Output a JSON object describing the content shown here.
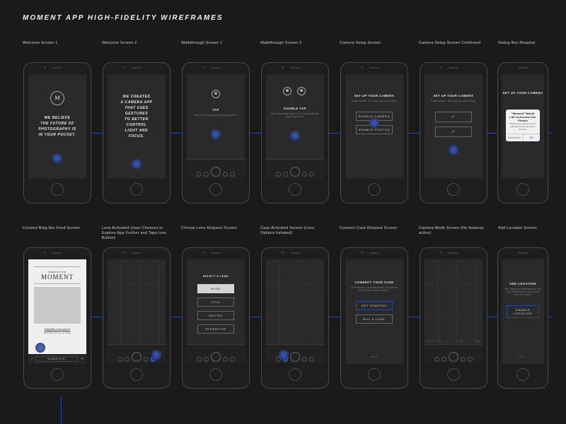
{
  "page_title": "MOMENT APP HIGH-FIDELITY WIREFRAMES",
  "accent_color": "#2b4a8f",
  "row1": [
    {
      "label": "Welcome Screen 1",
      "logo_letter": "M",
      "body": "WE BELIEVE\nTHE FUTURE OF\nPHOTOGRAPHY IS\nIN YOUR POCKET."
    },
    {
      "label": "Welcome Screen 2",
      "body": "WE CREATED\nA CAMERA APP\nTHAT USES\nGESTURES\nTO BETTER\nCONTROL\nLIGHT AND\nFOCUS."
    },
    {
      "label": "Walkthrough Screen 1",
      "gesture_title": "TAP",
      "gesture_sub": "Tap to set focus and exposure points."
    },
    {
      "label": "Walkthrough Screen 2",
      "gesture_title": "DOUBLE TAP",
      "gesture_sub": "Split focus and exposure to independently adjust each one."
    },
    {
      "label": "Camera Setup Screen",
      "title": "SET UP YOUR CAMERA",
      "sub": "To get started, we need your permission.",
      "buttons": [
        "ENABLE CAMERA",
        "ENABLE PHOTOS"
      ]
    },
    {
      "label": "Camera Setup Screen Confirmed",
      "title": "SET UP YOUR CAMERA",
      "sub": "To get started, we need your permission.",
      "checks": 2
    },
    {
      "label": "Dialog Box Request",
      "title": "SET UP YOUR CAMERA",
      "dialog_title": "\"Moment\" Would Like to Access Your Photos",
      "dialog_body": "Sharing your photos lets you edit and preview directly in the app.",
      "dialog_left": "Don't Allow",
      "dialog_right": "OK"
    }
  ],
  "row2": [
    {
      "label": "Curated Blog-like Feed Screen",
      "eyebrow": "Capture the",
      "hero": "MOMENT",
      "footer_link": "Everything I know and Do",
      "footer_sub": "Read More Photos | 2 Saves",
      "tab_label": "MOMENTS"
    },
    {
      "label": "Lens Activated (User Chooses to Explore App Further and Taps Icon Button)",
      "toolbar_active": true
    },
    {
      "label": "Choose Lens Request Screen",
      "title": "SELECT A LENS",
      "options": [
        "WIDE",
        "TELE",
        "MACRO",
        "SUPERFISH"
      ],
      "selected": "WIDE"
    },
    {
      "label": "Case Activated Screen (Lens Options Initiated)"
    },
    {
      "label": "Connect Case Request Screen",
      "title": "CONNECT YOUR CASE",
      "sub": "The Moment Case transforms your phone into an even better camera.",
      "buttons": [
        "GET STARTED",
        "BUY A CASE"
      ],
      "primary": 0,
      "skip": "SKIP"
    },
    {
      "label": "Camera Mode Screen (No features active)",
      "modes": [
        "AUTO",
        "ISO",
        "S",
        "F",
        "WB",
        "+/-",
        "FPS"
      ]
    },
    {
      "label": "Add Location Screen",
      "title": "ADD LOCATION",
      "sub": "We need your permission to tag your Moments with the place you took them.",
      "button": "ENABLE LOCATION",
      "skip": "SKIP"
    }
  ]
}
